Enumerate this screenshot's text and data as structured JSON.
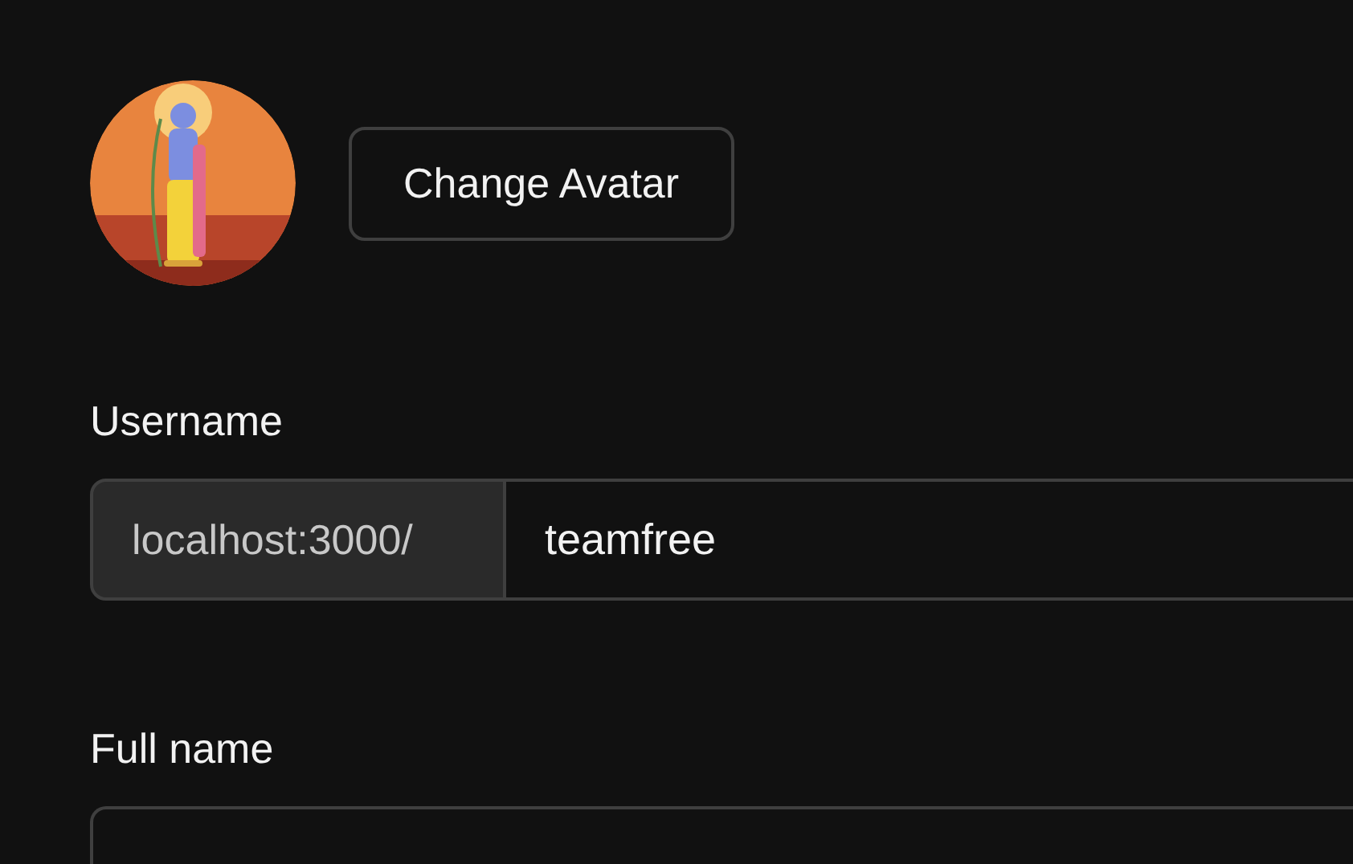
{
  "change_avatar_button": {
    "label": "Change Avatar"
  },
  "fields": [
    {
      "kind": "prefixed",
      "label": "Username",
      "prefix": "localhost:3000/",
      "value": "teamfree"
    },
    {
      "kind": "plain",
      "label": "Full name"
    }
  ]
}
